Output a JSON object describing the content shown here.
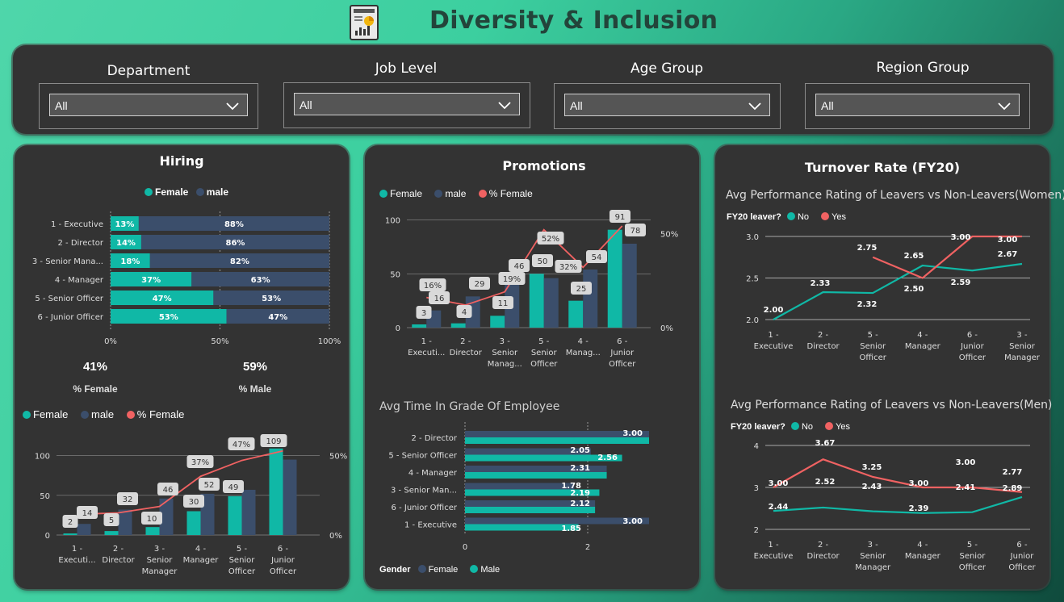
{
  "title": "Diversity & Inclusion",
  "colors": {
    "female": "#10b8a6",
    "male": "#3b4e6b",
    "pct": "#f06262",
    "no": "#10b8a6",
    "yes": "#f06262"
  },
  "filters": [
    {
      "label": "Department",
      "value": "All"
    },
    {
      "label": "Job Level",
      "value": "All"
    },
    {
      "label": "Age Group",
      "value": "All"
    },
    {
      "label": "Region Group",
      "value": "All"
    }
  ],
  "hiring": {
    "title": "Hiring",
    "legend": {
      "female": "Female",
      "male": "male"
    },
    "kpi": {
      "female_value": "41%",
      "female_label": "% Female",
      "male_value": "59%",
      "male_label": "% Male"
    },
    "legend2": {
      "female": "Female",
      "male": "male",
      "pct": "% Female"
    }
  },
  "promotions": {
    "title": "Promotions",
    "legend": {
      "female": "Female",
      "male": "male",
      "pct": "% Female"
    }
  },
  "time_in_grade": {
    "title": "Avg Time In Grade Of Employee",
    "legend_title": "Gender",
    "legend": {
      "female": "Female",
      "male": "Male"
    }
  },
  "turnover": {
    "title": "Turnover Rate (FY20)",
    "women_title": "Avg Performance Rating of Leavers vs Non-Leavers(Women)",
    "men_title": "Avg Performance Rating of Leavers vs Non-Leavers(Men)",
    "legend_title": "FY20 leaver?",
    "legend": {
      "no": "No",
      "yes": "Yes"
    }
  },
  "chart_data": [
    {
      "id": "hiring-stacked",
      "type": "bar",
      "orientation": "horizontal-100%-stacked",
      "categories": [
        "1 - Executive",
        "2 - Director",
        "3 - Senior Mana...",
        "4 - Manager",
        "5 - Senior Officer",
        "6 - Junior Officer"
      ],
      "series": [
        {
          "name": "Female",
          "values": [
            13,
            14,
            18,
            37,
            47,
            53
          ],
          "labels": [
            "13%",
            "14%",
            "18%",
            "37%",
            "47%",
            "53%"
          ]
        },
        {
          "name": "male",
          "values": [
            88,
            86,
            82,
            63,
            53,
            47
          ],
          "labels": [
            "88%",
            "86%",
            "82%",
            "63%",
            "53%",
            "47%"
          ]
        }
      ],
      "xticks": [
        "0%",
        "50%",
        "100%"
      ]
    },
    {
      "id": "hiring-combo",
      "type": "bar",
      "categories": [
        "1 - Executi...",
        "2 - Director",
        "3 - Senior Manager",
        "4 - Manager",
        "5 - Senior Officer",
        "6 - Junior Officer"
      ],
      "series": [
        {
          "name": "Female",
          "values": [
            2,
            5,
            10,
            30,
            49,
            109
          ]
        },
        {
          "name": "male",
          "values": [
            14,
            32,
            46,
            52,
            57,
            95
          ]
        },
        {
          "name": "% Female",
          "values": [
            0.13,
            0.14,
            0.18,
            0.37,
            0.47,
            0.53
          ],
          "line": true
        }
      ],
      "bar_labels": [
        "2",
        "14",
        "5",
        "32",
        "10",
        "46",
        "30",
        "52",
        "49",
        "109"
      ],
      "pct_labels": [
        "37%",
        "47%"
      ],
      "yticks": [
        "0",
        "50",
        "100"
      ],
      "y2ticks": [
        "0%",
        "50%"
      ],
      "ylim": [
        0,
        120
      ],
      "y2lim": [
        0,
        0.6
      ]
    },
    {
      "id": "promotions-combo",
      "type": "bar",
      "categories": [
        "1 - Executi...",
        "2 - Director",
        "3 - Senior Manag...",
        "5 - Senior Officer",
        "4 - Manag...",
        "6 - Junior Officer"
      ],
      "series": [
        {
          "name": "Female",
          "values": [
            3,
            4,
            11,
            50,
            25,
            91
          ]
        },
        {
          "name": "male",
          "values": [
            16,
            29,
            46,
            46,
            54,
            78
          ]
        },
        {
          "name": "% Female",
          "values": [
            0.16,
            0.12,
            0.19,
            0.52,
            0.32,
            0.54
          ],
          "line": true
        }
      ],
      "bar_labels": [
        "3",
        "4",
        "29",
        "11",
        "46",
        "50",
        "25",
        "54",
        "91",
        "78"
      ],
      "pct_labels": [
        "16%",
        "16",
        "19%",
        "52%",
        "32%"
      ],
      "yticks": [
        "0",
        "50",
        "100"
      ],
      "y2ticks": [
        "0%",
        "50%"
      ],
      "ylim": [
        0,
        105
      ],
      "y2lim": [
        0,
        0.6
      ]
    },
    {
      "id": "time-in-grade",
      "type": "bar",
      "orientation": "horizontal-clustered",
      "categories": [
        "2 - Director",
        "5 - Senior Officer",
        "4 - Manager",
        "3 - Senior Man...",
        "6 - Junior Officer",
        "1 - Executive"
      ],
      "series": [
        {
          "name": "Female",
          "values": [
            3.0,
            2.05,
            2.31,
            1.78,
            2.12,
            3.0
          ]
        },
        {
          "name": "Male",
          "values": [
            3.0,
            2.56,
            2.31,
            2.19,
            2.12,
            1.85
          ]
        }
      ],
      "labels": [
        "3.00",
        "2.05",
        "2.56",
        "2.31",
        "1.78",
        "2.19",
        "2.12",
        "3.00",
        "1.85"
      ],
      "xticks": [
        "0",
        "2"
      ],
      "xlim": [
        0,
        3.5
      ]
    },
    {
      "id": "turnover-women",
      "type": "line",
      "categories": [
        "1 - Executive",
        "2 - Director",
        "5 - Senior Officer",
        "4 - Manager",
        "6 - Junior Officer",
        "3 - Senior Manager"
      ],
      "series": [
        {
          "name": "No",
          "values": [
            2.0,
            2.33,
            2.32,
            2.65,
            2.59,
            2.67
          ]
        },
        {
          "name": "Yes",
          "values": [
            null,
            null,
            2.75,
            2.5,
            3.0,
            3.0
          ]
        }
      ],
      "labels": [
        "2.00",
        "2.33",
        "2.32",
        "2.75",
        "2.65",
        "2.50",
        "2.59",
        "3.00",
        "3.00",
        "2.67"
      ],
      "yticks": [
        "2.0",
        "2.5",
        "3.0"
      ],
      "ylim": [
        2.0,
        3.0
      ]
    },
    {
      "id": "turnover-men",
      "type": "line",
      "categories": [
        "1 - Executive",
        "2 - Director",
        "3 - Senior Manager",
        "4 - Manager",
        "5 - Senior Officer",
        "6 - Junior Officer"
      ],
      "series": [
        {
          "name": "No",
          "values": [
            2.44,
            2.52,
            2.43,
            2.39,
            2.41,
            2.77
          ]
        },
        {
          "name": "Yes",
          "values": [
            3.0,
            3.67,
            3.25,
            3.0,
            3.0,
            2.89
          ]
        }
      ],
      "labels": [
        "3.00",
        "2.44",
        "3.67",
        "2.52",
        "3.25",
        "2.43",
        "3.00",
        "2.39",
        "3.00",
        "2.41",
        "2.77",
        "2.89"
      ],
      "yticks": [
        "2",
        "3",
        "4"
      ],
      "ylim": [
        2,
        4
      ]
    }
  ]
}
